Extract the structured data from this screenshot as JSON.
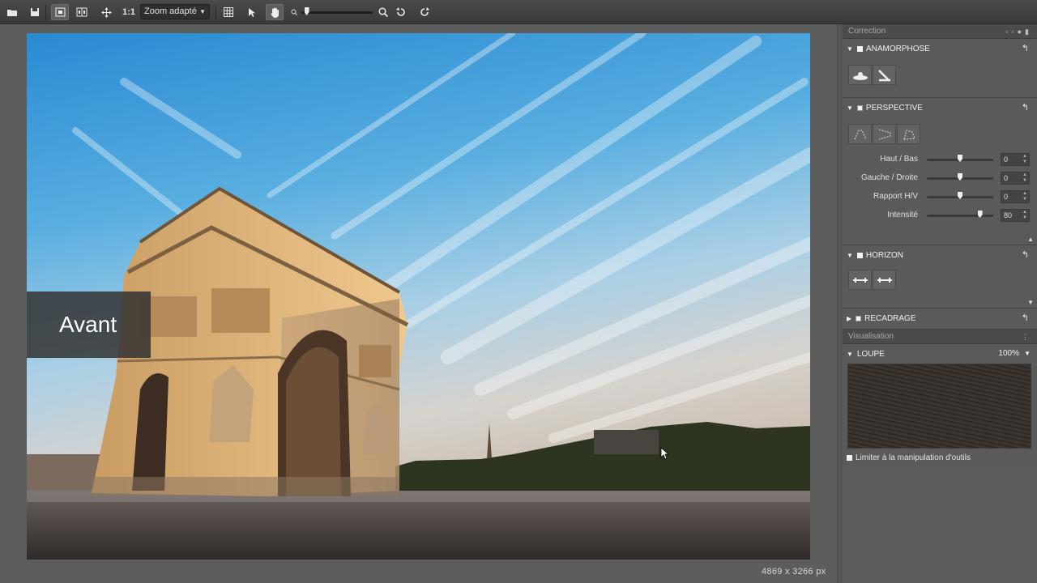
{
  "toolbar": {
    "icons": [
      "folder-open-icon",
      "save-icon",
      "view-single-icon",
      "view-split-icon",
      "move-icon",
      "zoom-one-to-one-icon",
      "grid-icon",
      "select-arrow-icon",
      "hand-icon",
      "zoom-small-icon",
      "zoom-magnifier-icon",
      "rotate-left-icon",
      "rotate-right-icon"
    ],
    "ratio_label": "1:1",
    "zoom_select_value": "Zoom adapté",
    "zoom_level_fraction": 0.04
  },
  "preview": {
    "overlay_label": "Avant",
    "dimensions": "4869 x 3266 px"
  },
  "panel": {
    "title": "Correction",
    "sections": {
      "anamorphose": {
        "label": "ANAMORPHOSE",
        "checked": false,
        "icons": [
          "anamorphose-horizontal-icon",
          "anamorphose-diagonal-icon"
        ]
      },
      "perspective": {
        "label": "PERSPECTIVE",
        "checked": true,
        "icons": [
          "perspective-vertical-icon",
          "perspective-horizontal-icon",
          "perspective-free-icon"
        ],
        "sliders": [
          {
            "label": "Haut / Bas",
            "value": "0",
            "position": 0.5
          },
          {
            "label": "Gauche / Droite",
            "value": "0",
            "position": 0.5
          },
          {
            "label": "Rapport H/V",
            "value": "0",
            "position": 0.5
          },
          {
            "label": "Intensité",
            "value": "80",
            "position": 0.8
          }
        ]
      },
      "horizon": {
        "label": "HORIZON",
        "checked": false,
        "icons": [
          "horizon-level-icon",
          "horizon-auto-icon"
        ]
      },
      "recadrage": {
        "label": "RECADRAGE",
        "checked": true
      }
    },
    "visualisation": {
      "title": "Visualisation",
      "loupe_label": "LOUPE",
      "loupe_zoom": "100%",
      "limit_checkbox_label": "Limiter à la manipulation d'outils"
    }
  },
  "colors": {
    "sky_top": "#2f8fd6",
    "stone": "#e8c08a",
    "panel_bg": "#5b5b5b"
  }
}
